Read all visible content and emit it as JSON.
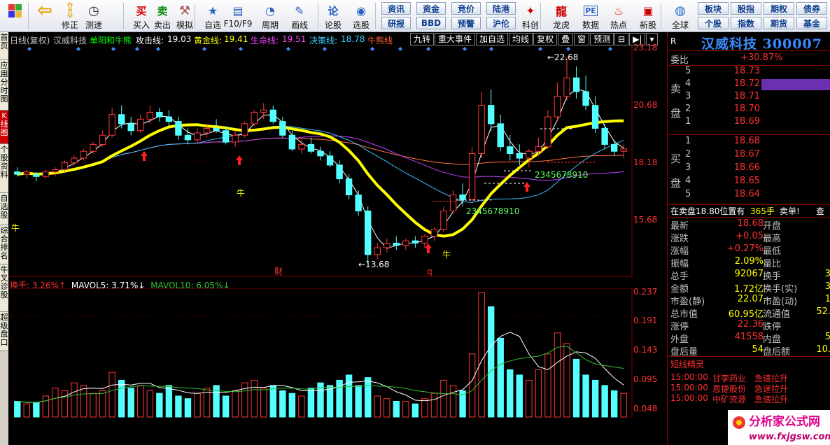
{
  "toolbar": {
    "left": [
      {
        "label": "",
        "icon": "windows-logo-icon"
      },
      {
        "label": "",
        "icon": "back-arrow-icon"
      },
      {
        "label": "修正",
        "icon": "up-down-arrows-icon"
      },
      {
        "label": "测速",
        "icon": "clock-icon"
      },
      {
        "label": "买入",
        "icon": "buy-icon",
        "glyph": "买"
      },
      {
        "label": "卖出",
        "icon": "sell-icon",
        "glyph": "卖"
      },
      {
        "label": "模拟",
        "icon": "hammer-icon"
      },
      {
        "label": "自选",
        "icon": "star-folder-icon"
      },
      {
        "label": "F10/F9",
        "icon": "f10-window-icon"
      },
      {
        "label": "周期",
        "icon": "period-icon"
      },
      {
        "label": "画线",
        "icon": "pencil-icon"
      },
      {
        "label": "论股",
        "icon": "discuss-icon",
        "glyph": "论"
      },
      {
        "label": "选股",
        "icon": "stock-select-icon"
      }
    ],
    "buttons_row1": [
      "资讯",
      "资金",
      "竞价",
      "陆港"
    ],
    "buttons_row2": [
      "研报",
      "BBD",
      "预警",
      "沪伦"
    ],
    "right": [
      {
        "label": "科创",
        "icon": "kechuang-icon"
      },
      {
        "label": "龙虎",
        "icon": "dragon-tiger-icon"
      },
      {
        "label": "数据",
        "icon": "data-pe-icon"
      },
      {
        "label": "热点",
        "icon": "hot-fire-icon"
      },
      {
        "label": "新股",
        "icon": "new-stock-icon"
      },
      {
        "label": "全球",
        "icon": "globe-icon"
      }
    ],
    "buttons_right_row1": [
      "板块",
      "股指",
      "期权",
      "债券"
    ],
    "buttons_right_row2": [
      "个股",
      "指数",
      "期货",
      "基金"
    ]
  },
  "left_tabs": [
    "首页",
    "应用",
    "分时图",
    "K线图",
    "个股资料",
    "自选股",
    "综合排名",
    "牛叉诊股",
    "超级盘口"
  ],
  "chart_header": {
    "period": "日线(复权)",
    "name": "汉威科技",
    "indicator": "单阳和牛熊",
    "attack_label": "攻击线:",
    "attack_value": "19.03",
    "gold_label": "黄金线:",
    "gold_value": "19.41",
    "life_label": "生命线:",
    "life_value": "19.51",
    "decision_label": "决策线:",
    "decision_value": "18.78",
    "bullbear": "牛熊线"
  },
  "chart_controls": [
    "九转",
    "重大事件",
    "加自选",
    "均线",
    "复权",
    "叠",
    "窗",
    "预测",
    "⊟",
    "▶|",
    "▾"
  ],
  "price_axis": [
    "23.18",
    "20.68",
    "18.18",
    "15.68"
  ],
  "volume_axis": [
    "0.237",
    "0.191",
    "0.143",
    "0.095",
    "0.048"
  ],
  "annotations": {
    "high": "22.68",
    "low": "13.68",
    "code_label": "2345678910",
    "bull": "牛",
    "cai": "财",
    "q": "q"
  },
  "volume_header": {
    "turnover": "换手: 3.26%↑",
    "mavol5": "MAVOL5: 3.71%↓",
    "mavol10": "MAVOL10: 6.05%↓"
  },
  "stock": {
    "tag": "R",
    "title": "汉威科技 300007",
    "weibi_label": "委比",
    "weibi_value": "+30.87%",
    "sell_label": "卖盘",
    "buy_label": "买盘",
    "asks": [
      {
        "level": "5",
        "price": "18.73"
      },
      {
        "level": "4",
        "price": "18.72"
      },
      {
        "level": "3",
        "price": "18.71"
      },
      {
        "level": "2",
        "price": "18.70"
      },
      {
        "level": "1",
        "price": "18.69"
      }
    ],
    "bids": [
      {
        "level": "1",
        "price": "18.68"
      },
      {
        "level": "2",
        "price": "18.67"
      },
      {
        "level": "3",
        "price": "18.66"
      },
      {
        "level": "4",
        "price": "18.65"
      },
      {
        "level": "5",
        "price": "18.64"
      }
    ],
    "notice_prefix": "在卖盘18.80位置有",
    "notice_qty": "365手",
    "notice_suffix": "卖单!",
    "notice_more": "查",
    "stats": [
      {
        "a": "最新",
        "v": "18.68",
        "vc": "red",
        "b": "开盘",
        "w": ""
      },
      {
        "a": "涨跌",
        "v": "+0.05",
        "vc": "red",
        "b": "最高",
        "w": ""
      },
      {
        "a": "涨幅",
        "v": "+0.27%",
        "vc": "red",
        "b": "最低",
        "w": ""
      },
      {
        "a": "振幅",
        "v": "2.09%",
        "vc": "yel",
        "b": "量比",
        "w": ""
      },
      {
        "a": "总手",
        "v": "92067",
        "vc": "yel",
        "b": "换手",
        "w": "3"
      },
      {
        "a": "金额",
        "v": "1.72亿",
        "vc": "yel",
        "b": "换手(实)",
        "w": "3"
      },
      {
        "a": "市盈(静)",
        "v": "22.07",
        "vc": "yel",
        "b": "市盈(动)",
        "w": "1"
      },
      {
        "a": "总市值",
        "v": "60.95亿",
        "vc": "yel",
        "b": "流通值",
        "w": "52."
      },
      {
        "a": "涨停",
        "v": "22.36",
        "vc": "red",
        "b": "跌停",
        "w": ""
      },
      {
        "a": "外盘",
        "v": "41558",
        "vc": "red",
        "b": "内盘",
        "w": "5"
      },
      {
        "a": "盘后量",
        "v": "54",
        "vc": "yel",
        "b": "盘后额",
        "w": "10."
      }
    ],
    "short_title": "短线精灵",
    "short_items": [
      {
        "time": "15:00:00",
        "name": "甘李药业",
        "event": "急速拉升"
      },
      {
        "time": "15:00:00",
        "name": "恩捷股份",
        "event": "急速拉升"
      },
      {
        "time": "15:00:00",
        "name": "中矿资源",
        "event": "急速拉升"
      }
    ]
  },
  "watermark": {
    "title": "分析家公式网",
    "url": "www.fxjgsw.com"
  },
  "chart_data": {
    "type": "candlestick",
    "price_ticks": [
      23.18,
      20.68,
      18.18,
      15.68
    ],
    "volume_ticks": [
      0.237,
      0.191,
      0.143,
      0.095,
      0.048
    ],
    "ohlc": [
      [
        17.7,
        17.9,
        17.5,
        17.6
      ],
      [
        17.6,
        17.8,
        17.4,
        17.7
      ],
      [
        17.6,
        17.7,
        17.3,
        17.5
      ],
      [
        17.5,
        17.8,
        17.4,
        17.7
      ],
      [
        17.7,
        17.9,
        17.5,
        17.8
      ],
      [
        17.8,
        18.2,
        17.7,
        18.1
      ],
      [
        18.1,
        18.4,
        18.0,
        18.3
      ],
      [
        18.3,
        18.7,
        18.2,
        18.6
      ],
      [
        18.6,
        19.0,
        18.5,
        18.9
      ],
      [
        18.9,
        19.5,
        18.8,
        19.3
      ],
      [
        19.3,
        20.5,
        19.2,
        20.2
      ],
      [
        20.2,
        20.6,
        19.6,
        19.8
      ],
      [
        19.8,
        20.1,
        19.3,
        19.5
      ],
      [
        19.5,
        20.2,
        19.4,
        20.0
      ],
      [
        20.0,
        20.6,
        19.8,
        20.3
      ],
      [
        20.3,
        20.5,
        19.9,
        20.1
      ],
      [
        20.1,
        20.4,
        19.7,
        19.9
      ],
      [
        19.9,
        20.1,
        19.1,
        19.3
      ],
      [
        19.3,
        19.6,
        18.9,
        19.1
      ],
      [
        19.1,
        19.6,
        18.9,
        19.4
      ],
      [
        19.4,
        19.8,
        19.2,
        19.6
      ],
      [
        19.6,
        20.0,
        19.4,
        19.5
      ],
      [
        19.5,
        19.7,
        18.9,
        19.0
      ],
      [
        19.0,
        19.5,
        18.8,
        19.3
      ],
      [
        19.3,
        19.9,
        19.2,
        19.8
      ],
      [
        19.8,
        20.4,
        19.7,
        20.3
      ],
      [
        20.3,
        20.7,
        20.0,
        20.4
      ],
      [
        20.4,
        20.6,
        19.8,
        19.9
      ],
      [
        19.9,
        20.1,
        19.2,
        19.3
      ],
      [
        19.3,
        19.5,
        18.6,
        18.7
      ],
      [
        18.7,
        19.1,
        18.5,
        18.9
      ],
      [
        18.9,
        19.2,
        18.5,
        18.6
      ],
      [
        18.6,
        18.8,
        18.2,
        18.4
      ],
      [
        18.4,
        18.6,
        17.9,
        18.0
      ],
      [
        18.0,
        18.2,
        17.2,
        17.4
      ],
      [
        17.4,
        17.6,
        16.5,
        16.7
      ],
      [
        16.7,
        16.9,
        15.8,
        16.0
      ],
      [
        16.0,
        16.2,
        13.7,
        14.1
      ],
      [
        14.1,
        14.6,
        13.9,
        14.4
      ],
      [
        14.4,
        14.8,
        14.2,
        14.6
      ],
      [
        14.6,
        14.9,
        14.3,
        14.5
      ],
      [
        14.5,
        14.8,
        14.3,
        14.7
      ],
      [
        14.7,
        14.9,
        14.4,
        14.6
      ],
      [
        14.6,
        15.0,
        14.4,
        14.9
      ],
      [
        14.9,
        15.3,
        14.7,
        15.2
      ],
      [
        15.2,
        16.2,
        15.1,
        16.0
      ],
      [
        16.0,
        16.9,
        15.9,
        16.7
      ],
      [
        16.7,
        17.2,
        16.2,
        16.5
      ],
      [
        16.5,
        18.8,
        16.4,
        18.5
      ],
      [
        18.5,
        21.2,
        18.3,
        20.6
      ],
      [
        20.6,
        21.3,
        19.5,
        19.8
      ],
      [
        19.8,
        20.2,
        18.6,
        18.8
      ],
      [
        18.8,
        19.3,
        18.2,
        18.5
      ],
      [
        18.5,
        18.9,
        18.0,
        18.3
      ],
      [
        18.3,
        18.7,
        17.9,
        18.6
      ],
      [
        18.6,
        19.2,
        18.4,
        18.8
      ],
      [
        18.8,
        20.4,
        18.7,
        20.1
      ],
      [
        20.1,
        21.6,
        19.9,
        21.0
      ],
      [
        21.0,
        22.7,
        20.8,
        21.8
      ],
      [
        21.8,
        22.3,
        20.9,
        21.2
      ],
      [
        21.2,
        21.9,
        20.4,
        20.6
      ],
      [
        20.6,
        21.0,
        19.4,
        19.6
      ],
      [
        19.6,
        19.8,
        18.7,
        18.9
      ],
      [
        18.9,
        19.1,
        18.4,
        18.6
      ],
      [
        18.6,
        18.9,
        18.3,
        18.7
      ]
    ],
    "volume": [
      0.03,
      0.025,
      0.028,
      0.04,
      0.055,
      0.05,
      0.065,
      0.06,
      0.045,
      0.05,
      0.085,
      0.07,
      0.055,
      0.06,
      0.05,
      0.045,
      0.06,
      0.04,
      0.035,
      0.045,
      0.055,
      0.06,
      0.04,
      0.05,
      0.065,
      0.07,
      0.055,
      0.06,
      0.05,
      0.045,
      0.04,
      0.055,
      0.065,
      0.06,
      0.07,
      0.08,
      0.06,
      0.075,
      0.04,
      0.035,
      0.03,
      0.03,
      0.025,
      0.035,
      0.045,
      0.07,
      0.06,
      0.05,
      0.12,
      0.237,
      0.21,
      0.15,
      0.09,
      0.08,
      0.07,
      0.09,
      0.12,
      0.16,
      0.14,
      0.11,
      0.08,
      0.07,
      0.06,
      0.05,
      0.045
    ]
  }
}
